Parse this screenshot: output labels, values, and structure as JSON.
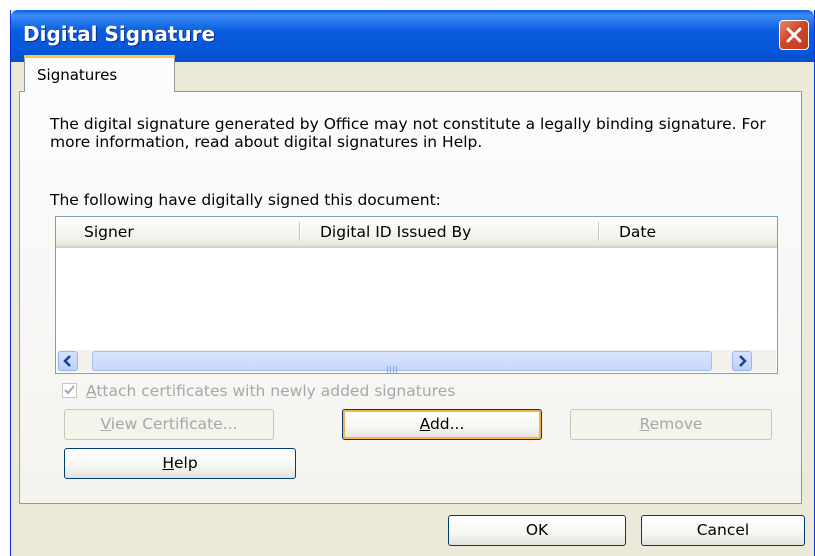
{
  "window": {
    "title": "Digital Signature"
  },
  "tabs": [
    {
      "label": "Signatures"
    }
  ],
  "description": "The digital signature generated by Office may not constitute a legally binding signature. For more information, read about digital signatures in Help.",
  "list": {
    "caption": "The following have digitally signed this document:",
    "columns": [
      "Signer",
      "Digital ID Issued By",
      "Date"
    ],
    "rows": []
  },
  "attach_checkbox": {
    "label_pre": "",
    "label_accel": "A",
    "label_post": "ttach certificates with newly added signatures",
    "checked": true,
    "enabled": false
  },
  "buttons": {
    "view_certificate": {
      "pre": "",
      "accel": "V",
      "post": "iew Certificate...",
      "enabled": false
    },
    "add": {
      "pre": "",
      "accel": "A",
      "post": "dd...",
      "enabled": true
    },
    "remove": {
      "pre": "",
      "accel": "R",
      "post": "emove",
      "enabled": false
    },
    "help": {
      "pre": "",
      "accel": "H",
      "post": "elp",
      "enabled": true
    },
    "ok": {
      "label": "OK"
    },
    "cancel": {
      "label": "Cancel"
    }
  },
  "colors": {
    "titlebar": "#0a5de0",
    "close": "#d2462a",
    "dialog_bg": "#ece9d8",
    "tab_accent": "#ffc83c",
    "default_focus": "#f5b34a"
  },
  "icons": {
    "close": "close-icon",
    "checkmark": "checkmark-icon",
    "scroll_left": "arrow-left-icon",
    "scroll_right": "arrow-right-icon"
  }
}
